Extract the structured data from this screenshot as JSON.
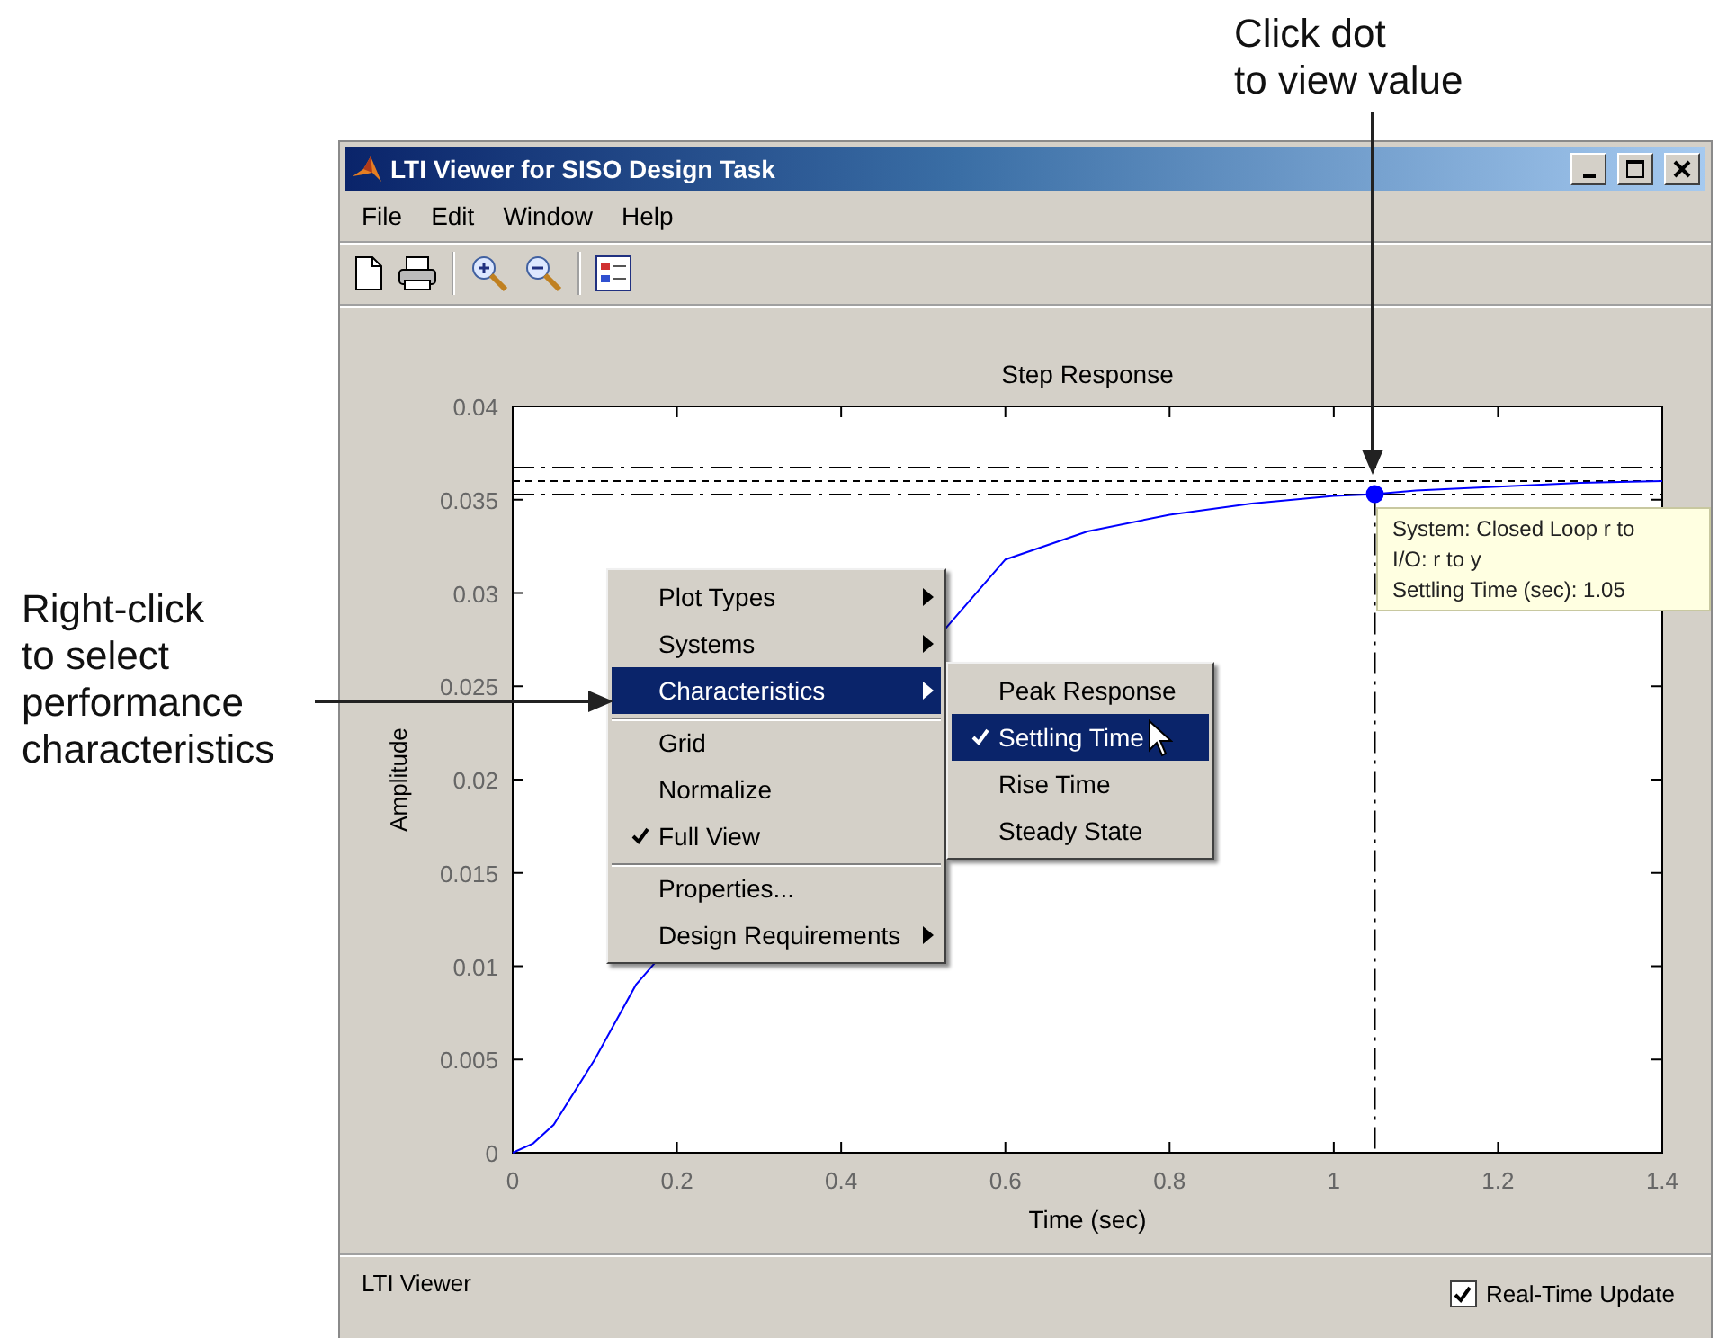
{
  "callouts": [
    {
      "text": "Click dot\nto view value",
      "kind": "down"
    },
    {
      "text": "Right-click\nto select\nperformance\ncharacteristics",
      "kind": "right"
    }
  ],
  "window": {
    "title": "LTI Viewer for SISO Design Task"
  },
  "menu_bar": [
    "File",
    "Edit",
    "Window",
    "Help"
  ],
  "chart_data": {
    "type": "line",
    "title": "Step Response",
    "xlabel": "Time (sec)",
    "ylabel": "Amplitude",
    "x": [
      0,
      0.025,
      0.05,
      0.1,
      0.15,
      0.6,
      0.7,
      0.8,
      0.9,
      1.0,
      1.05,
      1.1,
      1.2,
      1.3,
      1.4
    ],
    "series": [
      {
        "color": "#0000ff",
        "values": [
          0,
          0.0005,
          0.0015,
          0.005,
          0.009,
          0.0318,
          0.0333,
          0.0342,
          0.0348,
          0.0352,
          0.0353,
          0.0355,
          0.0357,
          0.0359,
          0.036
        ]
      }
    ],
    "xlim": [
      0,
      1.4
    ],
    "ylim": [
      0,
      0.04
    ],
    "xticks": [
      0,
      0.2,
      0.4,
      0.6,
      0.8,
      1,
      1.2,
      1.4
    ],
    "yticks": [
      0,
      0.005,
      0.01,
      0.015,
      0.02,
      0.025,
      0.03,
      0.035,
      0.04
    ]
  },
  "tooltip": [
    "System: Closed Loop r to",
    "I/O: r to y",
    "Settling Time (sec): 1.05"
  ],
  "context_menu": [
    {
      "label": "Plot Types",
      "kind": "submenu",
      "checked": false,
      "selected": false,
      "separator_before": false
    },
    {
      "label": "Systems",
      "kind": "submenu",
      "checked": false,
      "selected": false,
      "separator_before": false
    },
    {
      "label": "Characteristics",
      "kind": "submenu",
      "checked": false,
      "selected": true,
      "separator_before": false
    },
    {
      "label": "Grid",
      "kind": "item",
      "checked": false,
      "selected": false,
      "separator_before": true
    },
    {
      "label": "Normalize",
      "kind": "item",
      "checked": false,
      "selected": false,
      "separator_before": false
    },
    {
      "label": "Full View",
      "kind": "item",
      "checked": true,
      "selected": false,
      "separator_before": false
    },
    {
      "label": "Properties...",
      "kind": "item",
      "checked": false,
      "selected": false,
      "separator_before": true
    },
    {
      "label": "Design Requirements",
      "kind": "submenu",
      "checked": false,
      "selected": false,
      "separator_before": false
    }
  ],
  "submenu": [
    {
      "label": "Peak Response",
      "checked": false,
      "selected": false
    },
    {
      "label": "Settling Time",
      "checked": true,
      "selected": true
    },
    {
      "label": "Rise Time",
      "checked": false,
      "selected": false
    },
    {
      "label": "Steady State",
      "checked": false,
      "selected": false
    }
  ],
  "status_bar": {
    "text": "LTI Viewer",
    "checkbox": {
      "label": "Real-Time Update",
      "checked": true
    }
  }
}
